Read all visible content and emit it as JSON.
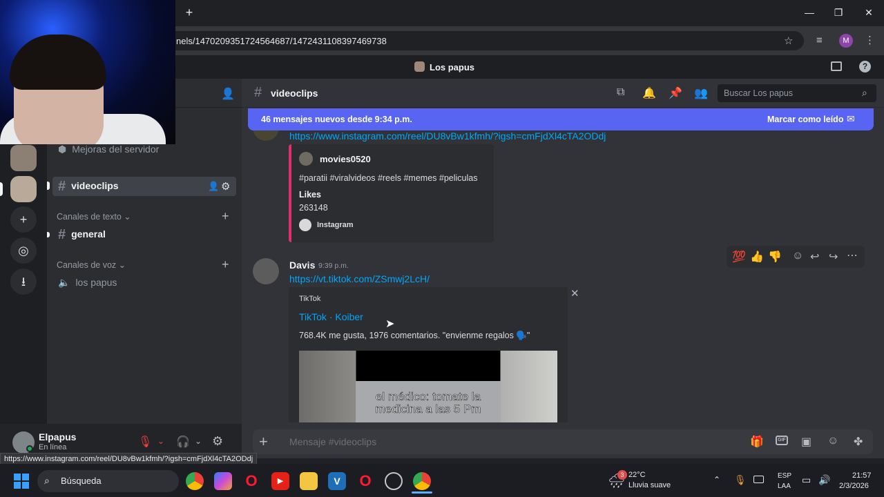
{
  "browser": {
    "url": "nels/1470209351724564687/1472431108397469738",
    "new_tab_icon": "plus-icon",
    "profile_initial": "M"
  },
  "discord": {
    "server_name": "Los papus",
    "server_boost_item": "Mejoras del servidor",
    "sidebar": {
      "active_channel": "videoclips",
      "text_category": "Canales de texto",
      "text_channels": [
        "general"
      ],
      "voice_category": "Canales de voz",
      "voice_channels": [
        "los papus"
      ]
    },
    "user": {
      "name": "Elpapus",
      "status": "En línea"
    },
    "chat": {
      "channel_name": "videoclips",
      "search_placeholder": "Buscar Los papus",
      "new_messages_banner": "46 mensajes nuevos desde 9:34 p.m.",
      "mark_read": "Marcar como leído",
      "messages": [
        {
          "link": "https://www.instagram.com/reel/DU8vBw1kfmh/?igsh=cmFjdXl4cTA2ODdj",
          "embed": {
            "author": "movies0520",
            "description": "#paratii #viralvideos #reels #memes #peliculas",
            "field_name": "Likes",
            "field_value": "263148",
            "footer": "Instagram"
          }
        },
        {
          "author": "Davis",
          "timestamp": "9:39 p.m.",
          "link": "https://vt.tiktok.com/ZSmwj2LcH/",
          "embed": {
            "provider": "TikTok",
            "title": "TikTok · Koiber",
            "description": "768.4K me gusta, 1976 comentarios. \"envienme regalos 🗣️\"",
            "video_caption": "el médico: tomate la medicina a las 5 Pm"
          }
        }
      ],
      "composer_placeholder": "Mensaje #videoclips"
    }
  },
  "status_url": "https://www.instagram.com/reel/DU8vBw1kfmh/?igsh=cmFjdXl4cTA2ODdj",
  "taskbar": {
    "search_label": "Búsqueda",
    "weather_temp": "22°C",
    "weather_desc": "Lluvia suave",
    "weather_badge": "3",
    "lang_line1": "ESP",
    "lang_line2": "LAA",
    "time": "21:57",
    "date": "2/3/2026"
  },
  "colors": {
    "blurple": "#5865f2",
    "link": "#00a8fc",
    "instagram_border": "#e1306c",
    "online": "#23a55a"
  }
}
